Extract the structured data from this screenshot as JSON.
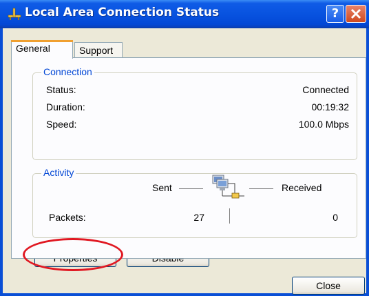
{
  "window": {
    "title": "Local Area Connection Status",
    "help_icon": "question-mark-icon",
    "close_icon": "close-x-icon",
    "title_icon": "network-connection-icon"
  },
  "tabs": [
    {
      "label": "General",
      "selected": true
    },
    {
      "label": "Support",
      "selected": false
    }
  ],
  "connection": {
    "heading": "Connection",
    "rows": [
      {
        "label": "Status:",
        "value": "Connected"
      },
      {
        "label": "Duration:",
        "value": "00:19:32"
      },
      {
        "label": "Speed:",
        "value": "100.0 Mbps"
      }
    ]
  },
  "activity": {
    "heading": "Activity",
    "sent_label": "Sent",
    "received_label": "Received",
    "packets_label": "Packets:",
    "packets_sent": "27",
    "packets_received": "0",
    "icon": "network-computers-icon"
  },
  "buttons": {
    "properties": "Properties",
    "disable": "Disable",
    "close": "Close"
  },
  "colors": {
    "titlebar": "#0853e0",
    "group_title": "#0046d5",
    "highlight": "#e01822"
  }
}
